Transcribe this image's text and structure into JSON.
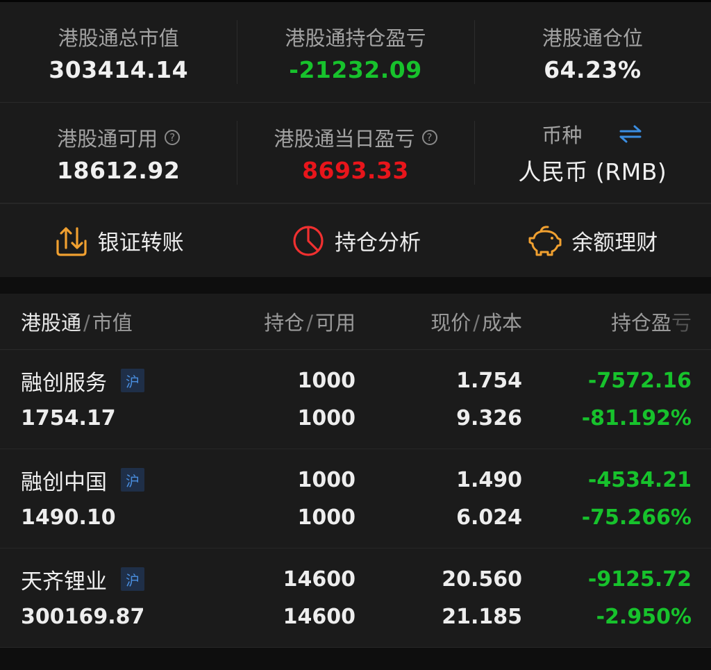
{
  "summary": {
    "total_value_label": "港股通总市值",
    "total_value": "303414.14",
    "holding_pnl_label": "港股通持仓盈亏",
    "holding_pnl": "-21232.09",
    "position_label": "港股通仓位",
    "position": "64.23%",
    "available_label": "港股通可用",
    "available": "18612.92",
    "daily_pnl_label": "港股通当日盈亏",
    "daily_pnl": "8693.33",
    "currency_label": "币种",
    "currency": "人民币 (RMB)",
    "help_glyph": "?"
  },
  "actions": [
    {
      "label": "银证转账",
      "icon": "transfer-icon"
    },
    {
      "label": "持仓分析",
      "icon": "pie-chart-icon"
    },
    {
      "label": "余额理财",
      "icon": "piggy-bank-icon"
    }
  ],
  "table": {
    "headers": {
      "col1_main": "港股通",
      "col1_sub": "市值",
      "col2_a": "持仓",
      "col2_b": "可用",
      "col3_a": "现价",
      "col3_b": "成本",
      "col4_main": "持仓盈",
      "col4_fade": "亏",
      "slash": "/"
    },
    "badge": "沪",
    "rows": [
      {
        "name": "融创服务",
        "market_value": "1754.17",
        "holding": "1000",
        "available": "1000",
        "price": "1.754",
        "cost": "9.326",
        "pnl": "-7572.16",
        "pnl_pct": "-81.192%"
      },
      {
        "name": "融创中国",
        "market_value": "1490.10",
        "holding": "1000",
        "available": "1000",
        "price": "1.490",
        "cost": "6.024",
        "pnl": "-4534.21",
        "pnl_pct": "-75.266%"
      },
      {
        "name": "天齐锂业",
        "market_value": "300169.87",
        "holding": "14600",
        "available": "14600",
        "price": "20.560",
        "cost": "21.185",
        "pnl": "-9125.72",
        "pnl_pct": "-2.950%"
      }
    ]
  },
  "colors": {
    "gain": "#e8151b",
    "loss": "#17c22c",
    "accent_orange": "#f0a030",
    "accent_blue": "#3b8de0"
  }
}
